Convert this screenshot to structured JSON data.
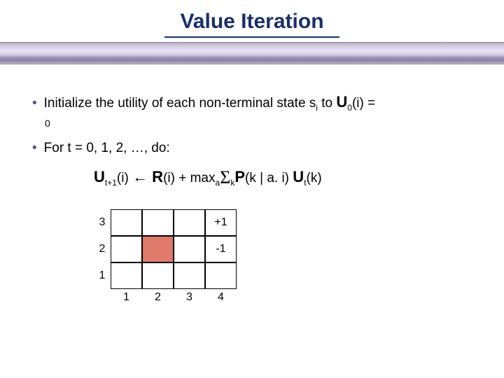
{
  "title": "Value Iteration",
  "bullets": {
    "b1_pre": "Initialize the utility of each non-terminal state s",
    "b1_sub_i": "i",
    "b1_mid": " to ",
    "b1_U": "U",
    "b1_Usub": "0",
    "b1_post": "(i) =",
    "b1_zero": "0",
    "b2": "For t = 0, 1, 2, …, do:"
  },
  "formula": {
    "U1": "U",
    "U1sub": "t+1",
    "U1post": "(i) ",
    "arrow": "←",
    "R": " R",
    "Rpost": "(i) + max",
    "maxsub": "a",
    "sigma": "Σ",
    "sigmasub": "k",
    "P": "P",
    "Ppost": "(k | a. i) ",
    "U2": "U",
    "U2sub": "t",
    "U2post": "(k)"
  },
  "grid": {
    "rows": [
      "3",
      "2",
      "1"
    ],
    "cols": [
      "1",
      "2",
      "3",
      "4"
    ],
    "reward_pos": "+1",
    "reward_neg": "-1"
  }
}
